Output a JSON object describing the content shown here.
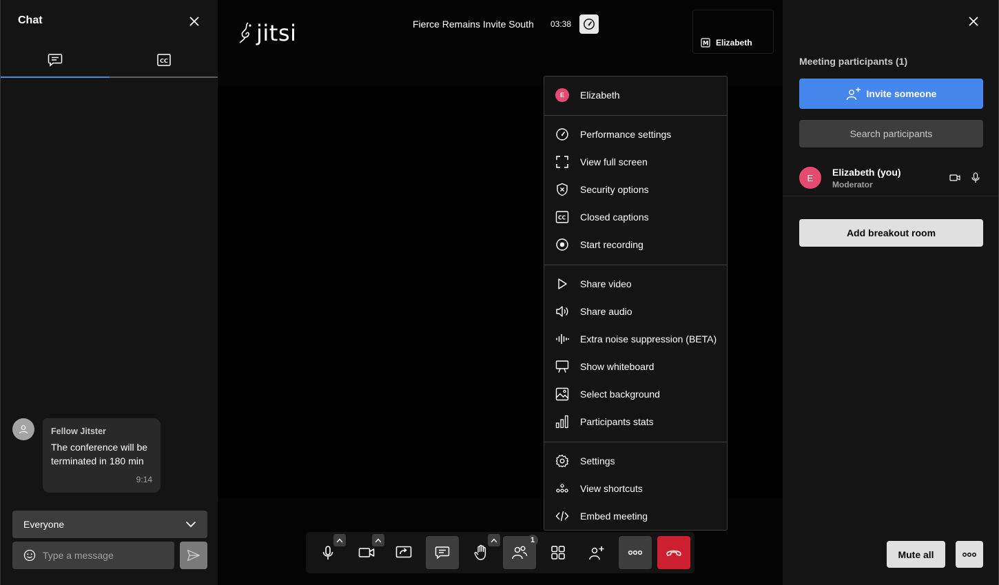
{
  "chat": {
    "title": "Chat",
    "tabs": [
      {
        "name": "chat-messages",
        "icon": "chat-bubble-icon"
      },
      {
        "name": "closed-captions",
        "icon": "cc-icon"
      }
    ],
    "messages": [
      {
        "sender": "Fellow Jitster",
        "text": "The conference will be terminated in 180 min",
        "time": "9:14"
      }
    ],
    "recipient": "Everyone",
    "input_placeholder": "Type a message"
  },
  "conference": {
    "logo_text": "jitsi",
    "meeting_title": "Fierce Remains Invite South",
    "timer": "03:38",
    "thumbnail": {
      "badge": "M",
      "name": "Elizabeth"
    },
    "toolbar": {
      "participants_count": "1"
    }
  },
  "menu": {
    "user": {
      "initial": "E",
      "name": "Elizabeth"
    },
    "groups": [
      [
        {
          "label": "Performance settings",
          "icon": "gauge-icon"
        },
        {
          "label": "View full screen",
          "icon": "fullscreen-icon"
        },
        {
          "label": "Security options",
          "icon": "shield-icon"
        },
        {
          "label": "Closed captions",
          "icon": "cc-icon"
        },
        {
          "label": "Start recording",
          "icon": "record-icon"
        }
      ],
      [
        {
          "label": "Share video",
          "icon": "play-icon"
        },
        {
          "label": "Share audio",
          "icon": "speaker-icon"
        },
        {
          "label": "Extra noise suppression (BETA)",
          "icon": "waveform-icon"
        },
        {
          "label": "Show whiteboard",
          "icon": "whiteboard-icon"
        },
        {
          "label": "Select background",
          "icon": "image-icon"
        },
        {
          "label": "Participants stats",
          "icon": "bar-chart-icon"
        }
      ],
      [
        {
          "label": "Settings",
          "icon": "gear-icon"
        },
        {
          "label": "View shortcuts",
          "icon": "shortcuts-icon"
        },
        {
          "label": "Embed meeting",
          "icon": "code-icon"
        }
      ]
    ]
  },
  "participants": {
    "title": "Meeting participants (1)",
    "invite_label": "Invite someone",
    "search_placeholder": "Search participants",
    "list": [
      {
        "initial": "E",
        "name": "Elizabeth (you)",
        "role": "Moderator"
      }
    ],
    "breakout_label": "Add breakout room",
    "mute_all_label": "Mute all"
  },
  "colors": {
    "accent": "#4687ed",
    "hangup": "#cc1f30",
    "avatar": "#e54b6f",
    "panel": "#141414",
    "stage": "#000000"
  }
}
